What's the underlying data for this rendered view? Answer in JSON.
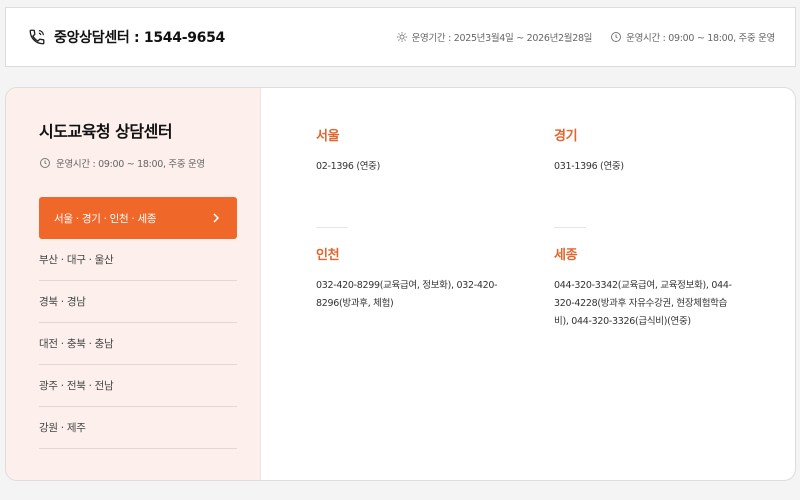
{
  "header": {
    "center_title": "중앙상담센터 : 1544-9654",
    "period": "운영기간 : 2025년3월4일 ~ 2026년2월28일",
    "hours": "운영시간 : 09:00 ~ 18:00, 주중 운영"
  },
  "sidebar": {
    "title": "시도교육청 상담센터",
    "hours": "운영시간 : 09:00 ~ 18:00, 주중 운영",
    "active": "서울 · 경기 · 인천 · 세종",
    "items": [
      {
        "label": "부산 · 대구 · 울산"
      },
      {
        "label": "경북 · 경남"
      },
      {
        "label": "대전 · 충북 · 충남"
      },
      {
        "label": "광주 · 전북 · 전남"
      },
      {
        "label": "강원 · 제주"
      }
    ]
  },
  "regions": {
    "seoul": {
      "name": "서울",
      "contact": "02-1396 (연중)"
    },
    "gyeonggi": {
      "name": "경기",
      "contact": "031-1396 (연중)"
    },
    "incheon": {
      "name": "인천",
      "contact": "032-420-8299(교육급여, 정보화), 032-420-8296(방과후, 체험)"
    },
    "sejong": {
      "name": "세종",
      "contact": "044-320-3342(교육급여, 교육정보화), 044-320-4228(방과후 자유수강권, 현장체험학습비), 044-320-3326(급식비)(연중)"
    }
  },
  "icons": {
    "phone": "phone-icon",
    "period": "sun-icon",
    "clock": "clock-icon",
    "chevron": "chevron-right-icon"
  },
  "colors": {
    "accent": "#f0672a",
    "region_title": "#e0662e",
    "sidebar_bg": "#fdf0ec"
  }
}
